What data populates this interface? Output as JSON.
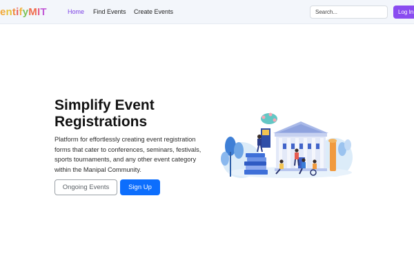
{
  "nav": {
    "brand_letters": [
      "e",
      "n",
      "t",
      "i",
      "f",
      "y",
      "M",
      "I",
      "T"
    ],
    "brand_colors": [
      "#f2a93b",
      "#e8c23a",
      "#f08a3c",
      "#e95d5d",
      "#f0b541",
      "#7fc35a",
      "#f06b4b",
      "#e45c8c",
      "#c25bd6"
    ],
    "links": [
      "Home",
      "Find Events",
      "Create Events"
    ],
    "search_placeholder": "Search...",
    "login_label": "Log In",
    "accent_color": "#8a4cf0",
    "active_link_color": "#7b3fe4"
  },
  "hero": {
    "title": "Simplify Event Registrations",
    "description": "Platform for effortlessly creating event registration forms that cater to conferences, seminars, festivals, sports tournaments, and any other event category within the Manipal Community.",
    "secondary_button": "Ongoing Events",
    "primary_button": "Sign Up",
    "primary_color": "#0d6efd",
    "illustration_icon": "university-event-illustration"
  }
}
